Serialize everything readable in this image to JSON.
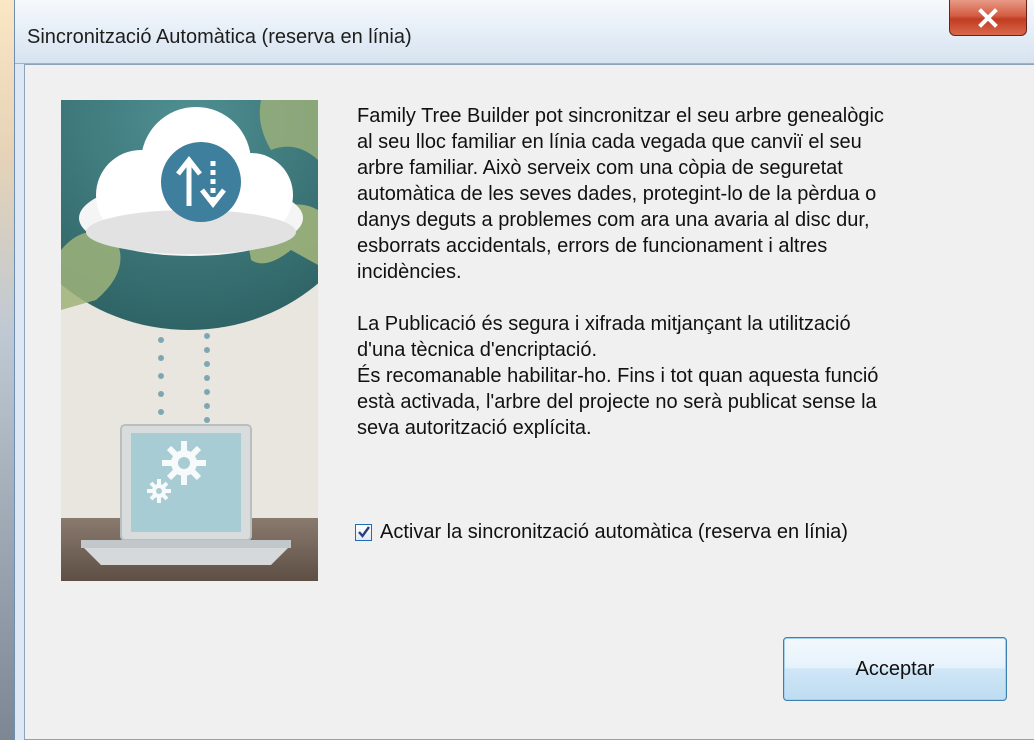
{
  "window": {
    "title": "Sincronització Automàtica (reserva en línia)"
  },
  "content": {
    "paragraph1": "Family Tree Builder pot sincronitzar el seu arbre genealògic\nal seu lloc familiar en línia cada vegada que canviï el seu\narbre familiar. Això serveix com una còpia de seguretat\nautomàtica de les seves dades, protegint-lo de la pèrdua o\ndanys deguts a problemes com ara una avaria al disc dur,\nesborrats accidentals, errors de funcionament i altres\nincidències.",
    "paragraph2": "La Publicació és segura i xifrada mitjançant la utilització\nd'una tècnica d'encriptació.\nÉs recomanable habilitar-ho. Fins i tot quan aquesta funció\nestà activada, l'arbre del projecte no serà publicat sense la\nseva autorització explícita."
  },
  "checkbox": {
    "label": "Activar la sincronització automàtica (reserva en línia)",
    "checked": true
  },
  "buttons": {
    "accept": "Acceptar"
  },
  "icons": {
    "close": "close-icon",
    "sync": "sync-arrows-icon",
    "gear": "gear-icon",
    "laptop": "laptop-icon",
    "cloud": "cloud-icon",
    "globe": "globe-icon"
  },
  "colors": {
    "close_red": "#c94a30",
    "accent_blue": "#3c7fb1",
    "sync_circle": "#3e7f9d",
    "laptop_screen": "#a7ccd3"
  }
}
